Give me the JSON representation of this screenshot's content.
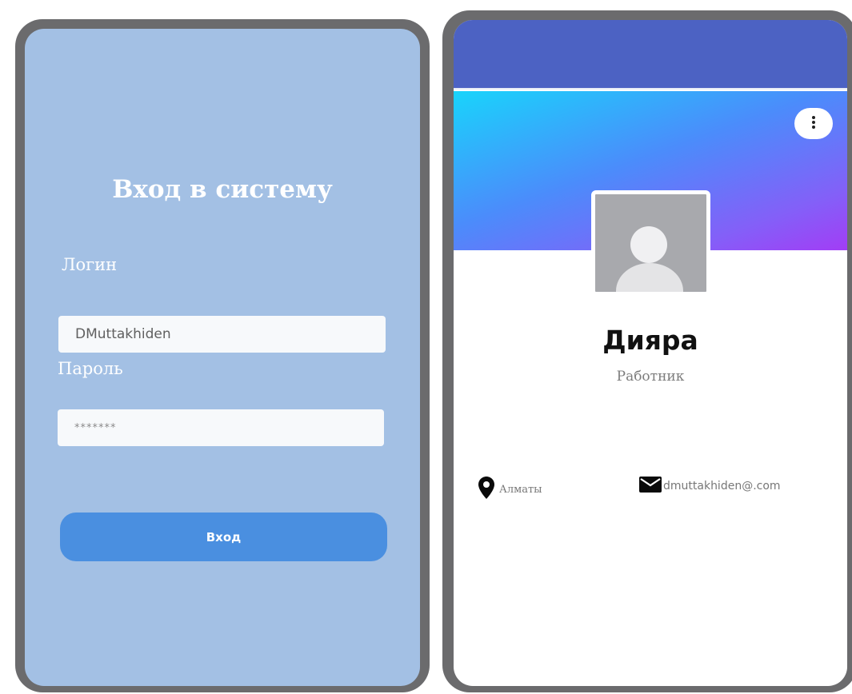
{
  "login": {
    "title": "Вход в систему",
    "login_label": "Логин",
    "login_value": "DMuttakhiden",
    "password_label": "Пароль",
    "password_value": "*******",
    "submit_label": "Вход"
  },
  "profile": {
    "name": "Дияра",
    "role": "Работник",
    "location": "Алматы",
    "email": "dmuttakhiden@.com"
  },
  "icons": {
    "menu": "more-vertical-icon",
    "avatar": "user-placeholder-icon",
    "location": "map-pin-icon",
    "email": "envelope-icon"
  },
  "colors": {
    "login_background": "#a3c0e4",
    "login_button": "#4a8fe0",
    "top_bar": "#4c62c3",
    "cover_gradient_start": "#19d4fb",
    "cover_gradient_end": "#a23df5",
    "device_frame": "#6b6b6d"
  }
}
